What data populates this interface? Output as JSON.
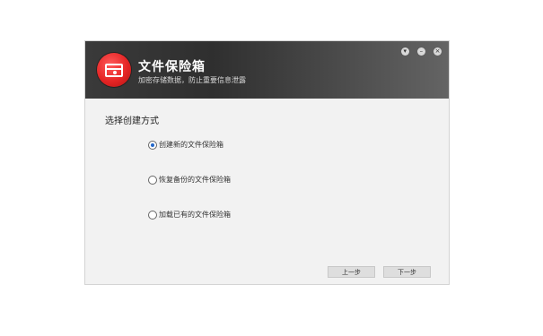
{
  "window": {
    "title": "文件保险箱",
    "subtitle": "加密存储数据，防止重要信息泄露",
    "controls": [
      "menu",
      "minimize",
      "close"
    ]
  },
  "section": {
    "title": "选择创建方式"
  },
  "options": [
    {
      "label": "创建新的文件保险箱",
      "selected": true
    },
    {
      "label": "恢复备份的文件保险箱",
      "selected": false
    },
    {
      "label": "加载已有的文件保险箱",
      "selected": false
    }
  ],
  "buttons": {
    "prev": "上一步",
    "next": "下一步"
  },
  "colors": {
    "header_dark": "#2f2f2f",
    "logo_red": "#e52525",
    "radio_accent": "#2468c9",
    "body_bg": "#f2f2f2"
  }
}
